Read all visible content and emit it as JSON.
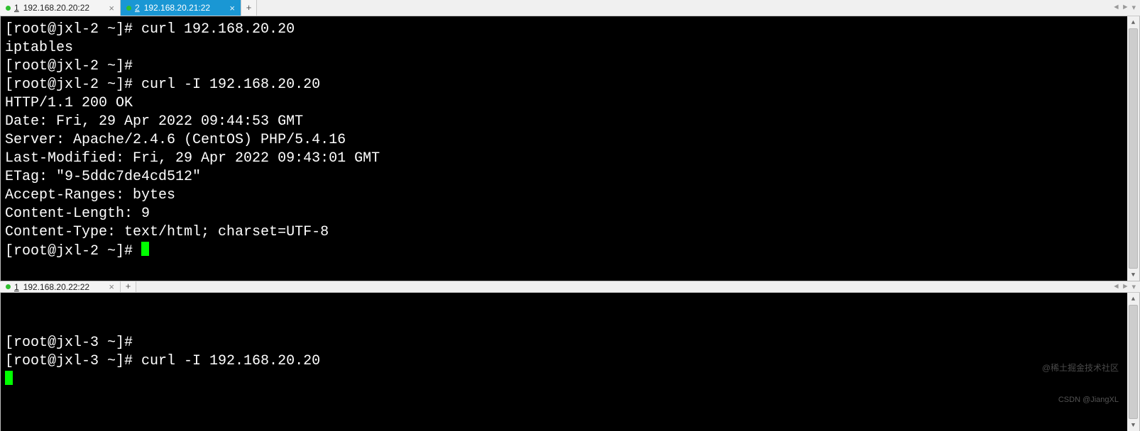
{
  "panes": {
    "top": {
      "tabs": [
        {
          "index": "1",
          "label": "192.168.20.20:22",
          "active": false
        },
        {
          "index": "2",
          "label": "192.168.20.21:22",
          "active": true
        }
      ],
      "lines": [
        "[root@jxl-2 ~]# curl 192.168.20.20",
        "iptables",
        "[root@jxl-2 ~]# ",
        "[root@jxl-2 ~]# curl -I 192.168.20.20",
        "HTTP/1.1 200 OK",
        "Date: Fri, 29 Apr 2022 09:44:53 GMT",
        "Server: Apache/2.4.6 (CentOS) PHP/5.4.16",
        "Last-Modified: Fri, 29 Apr 2022 09:43:01 GMT",
        "ETag: \"9-5ddc7de4cd512\"",
        "Accept-Ranges: bytes",
        "Content-Length: 9",
        "Content-Type: text/html; charset=UTF-8",
        "",
        "[root@jxl-2 ~]# "
      ],
      "cursor_line_index": 13
    },
    "bottom": {
      "tabs": [
        {
          "index": "1",
          "label": "192.168.20.22:22",
          "active": false
        }
      ],
      "lines": [
        "[root@jxl-3 ~]# ",
        "[root@jxl-3 ~]# curl -I 192.168.20.20"
      ],
      "cursor_new_line": true
    }
  },
  "nav_arrows": {
    "left": "◄",
    "right": "►",
    "down": "▾"
  },
  "newtab_glyph": "+",
  "close_glyph": "×",
  "watermark": {
    "line1": "@稀土掘金技术社区",
    "line2": "CSDN @JiangXL"
  }
}
